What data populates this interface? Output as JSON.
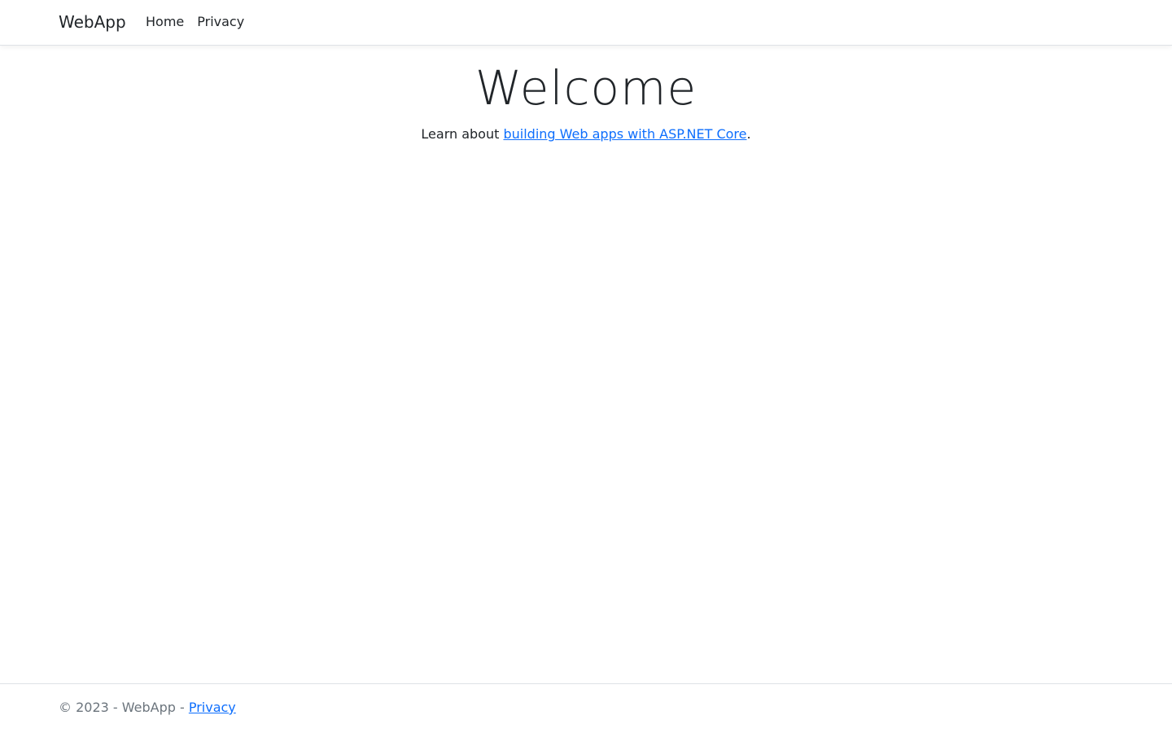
{
  "navbar": {
    "brand": "WebApp",
    "links": [
      {
        "label": "Home"
      },
      {
        "label": "Privacy"
      }
    ]
  },
  "main": {
    "heading": "Welcome",
    "lead_prefix": "Learn about ",
    "lead_link": "building Web apps with ASP.NET Core",
    "lead_suffix": "."
  },
  "footer": {
    "copyright": "© 2023 - WebApp - ",
    "privacy_link": "Privacy"
  },
  "colors": {
    "link": "#0d6efd",
    "text": "#212529",
    "muted": "#6c757d",
    "border": "#dee2e6"
  }
}
